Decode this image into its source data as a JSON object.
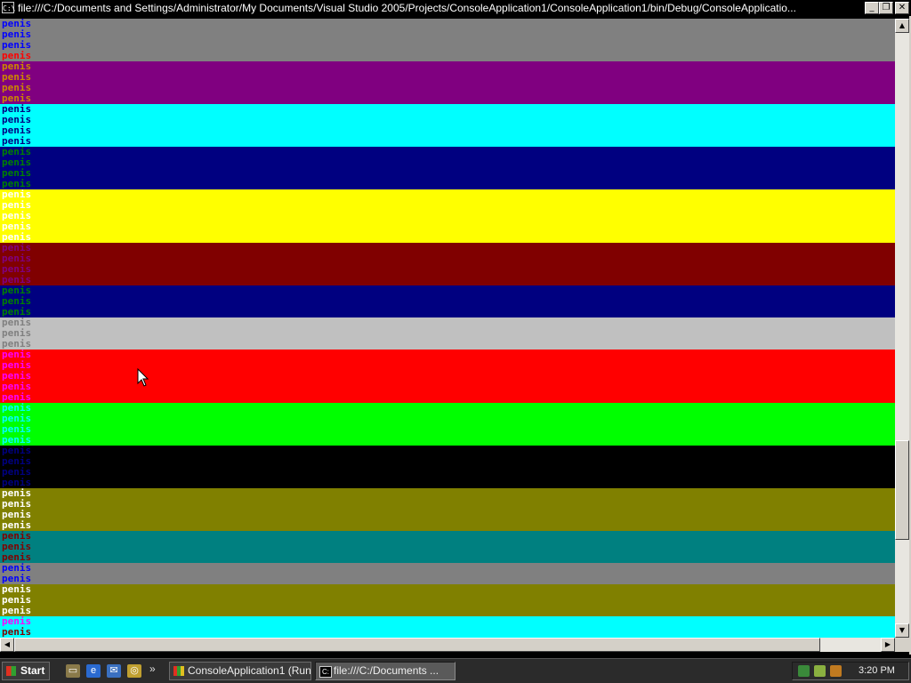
{
  "window": {
    "title": "file:///C:/Documents and Settings/Administrator/My Documents/Visual Studio 2005/Projects/ConsoleApplication1/ConsoleApplication1/bin/Debug/ConsoleApplicatio...",
    "system_icon_label": "C:\\",
    "minimize_symbol": "_",
    "maximize_symbol": "❐",
    "close_symbol": "✕"
  },
  "console": {
    "word": "penis",
    "bands": [
      {
        "color": "#808080",
        "text_colors": [
          "#0000ff",
          "#0000ff",
          "#0000ff",
          "#ff0000"
        ]
      },
      {
        "color": "#800080",
        "text_colors": [
          "#cc8800",
          "#cc8800",
          "#cc8800",
          "#cc8800"
        ]
      },
      {
        "color": "#00ffff",
        "text_colors": [
          "#000080",
          "#000080",
          "#000080",
          "#000080"
        ]
      },
      {
        "color": "#000080",
        "text_colors": [
          "#008000",
          "#008000",
          "#008000",
          "#008000"
        ]
      },
      {
        "color": "#ffff00",
        "text_colors": [
          "#ffffff",
          "#ffffff",
          "#ffffff",
          "#ffffff",
          "#ffffff"
        ]
      },
      {
        "color": "#800000",
        "text_colors": [
          "#800080",
          "#800080",
          "#800080",
          "#800080"
        ]
      },
      {
        "color": "#000080",
        "text_colors": [
          "#008000",
          "#008000",
          "#008000"
        ]
      },
      {
        "color": "#c0c0c0",
        "text_colors": [
          "#808080",
          "#808080",
          "#808080"
        ]
      },
      {
        "color": "#ff0000",
        "text_colors": [
          "#ff00ff",
          "#ff00ff",
          "#ff00ff",
          "#ff00ff",
          "#ff00ff"
        ]
      },
      {
        "color": "#00ff00",
        "text_colors": [
          "#00ffff",
          "#00ffff",
          "#00ffff",
          "#00ffff"
        ]
      },
      {
        "color": "#000000",
        "text_colors": [
          "#000080",
          "#000080",
          "#000080",
          "#000080"
        ]
      },
      {
        "color": "#808000",
        "text_colors": [
          "#ffffff",
          "#ffffff",
          "#ffffff",
          "#ffffff"
        ]
      },
      {
        "color": "#008080",
        "text_colors": [
          "#800000",
          "#800000",
          "#800000"
        ]
      },
      {
        "color": "#808080",
        "text_colors": [
          "#0000ff",
          "#0000ff"
        ]
      },
      {
        "color": "#808000",
        "text_colors": [
          "#ffffff",
          "#ffffff",
          "#ffffff"
        ]
      },
      {
        "color": "#00ffff",
        "text_colors": [
          "#ff00ff",
          "#800000"
        ]
      },
      {
        "color": "#008000",
        "text_colors": []
      }
    ]
  },
  "scrollbar": {
    "up_symbol": "▲",
    "down_symbol": "▼",
    "left_symbol": "◀",
    "right_symbol": "▶",
    "vertical_thumb_position": 0.83,
    "horizontal_thumb_fraction": 0.93
  },
  "taskbar": {
    "start_label": "Start",
    "quick_launch": [
      {
        "icon": "show-desktop-icon",
        "glyph": "▭",
        "color": "#8a7a4a"
      },
      {
        "icon": "internet-explorer-icon",
        "glyph": "e",
        "color": "#2a6ad0"
      },
      {
        "icon": "outlook-express-icon",
        "glyph": "✉",
        "color": "#3a70c0"
      },
      {
        "icon": "windows-media-icon",
        "glyph": "◎",
        "color": "#c0a030"
      }
    ],
    "more_symbol": "»",
    "tasks": [
      {
        "label": "ConsoleApplication1 (Run...",
        "icon": "visual-studio-icon",
        "active": false
      },
      {
        "label": "file:///C:/Documents ...",
        "icon": "console-icon",
        "active": true
      }
    ],
    "tray_icons": [
      {
        "icon": "network-icon",
        "color": "#3a8a3a"
      },
      {
        "icon": "printer-icon",
        "color": "#8ab040"
      },
      {
        "icon": "app-tray-icon",
        "color": "#c07a20"
      }
    ],
    "clock": "3:20 PM"
  }
}
